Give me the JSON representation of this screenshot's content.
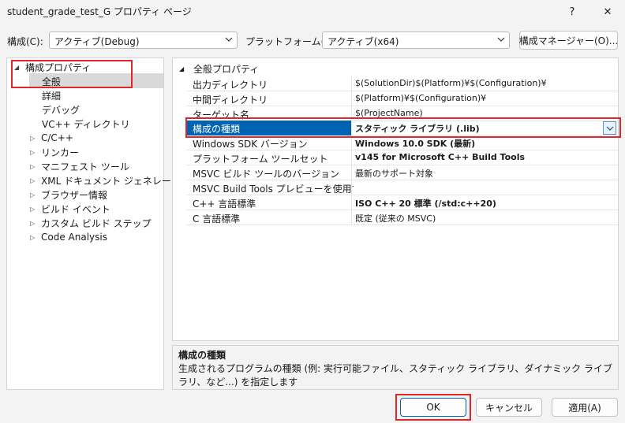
{
  "window": {
    "title": "student_grade_test_G プロパティ ページ",
    "help_label": "?",
    "close_label": "✕"
  },
  "toolbar": {
    "config_label": "構成(C):",
    "config_value": "アクティブ(Debug)",
    "platform_label": "プラットフォーム(P):",
    "platform_value": "アクティブ(x64)",
    "config_manager_label": "構成マネージャー(O)..."
  },
  "tree": {
    "root": {
      "label": "構成プロパティ",
      "expander": "◢"
    },
    "items": [
      {
        "label": "全般",
        "expander": ""
      },
      {
        "label": "詳細",
        "expander": ""
      },
      {
        "label": "デバッグ",
        "expander": ""
      },
      {
        "label": "VC++ ディレクトリ",
        "expander": ""
      },
      {
        "label": "C/C++",
        "expander": "▷"
      },
      {
        "label": "リンカー",
        "expander": "▷"
      },
      {
        "label": "マニフェスト ツール",
        "expander": "▷"
      },
      {
        "label": "XML ドキュメント ジェネレーター",
        "expander": "▷"
      },
      {
        "label": "ブラウザー情報",
        "expander": "▷"
      },
      {
        "label": "ビルド イベント",
        "expander": "▷"
      },
      {
        "label": "カスタム ビルド ステップ",
        "expander": "▷"
      },
      {
        "label": "Code Analysis",
        "expander": "▷"
      }
    ]
  },
  "grid": {
    "section_expander": "◢",
    "section_title": "全般プロパティ",
    "rows": [
      {
        "name": "出力ディレクトリ",
        "value": "$(SolutionDir)$(Platform)¥$(Configuration)¥"
      },
      {
        "name": "中間ディレクトリ",
        "value": "$(Platform)¥$(Configuration)¥"
      },
      {
        "name": "ターゲット名",
        "value": "$(ProjectName)"
      },
      {
        "name": "構成の種類",
        "value": "スタティック ライブラリ (.lib)"
      },
      {
        "name": "Windows SDK バージョン",
        "value": "Windows 10.0 SDK (最新)"
      },
      {
        "name": "プラットフォーム ツールセット",
        "value": "v145 for Microsoft C++ Build Tools"
      },
      {
        "name": "MSVC ビルド ツールのバージョン",
        "value": "最新のサポート対象"
      },
      {
        "name": "MSVC Build Tools プレビューを使用する",
        "value": ""
      },
      {
        "name": "C++ 言語標準",
        "value": "ISO C++ 20 標準 (/std:c++20)"
      },
      {
        "name": "C 言語標準",
        "value": "既定 (従来の MSVC)"
      }
    ]
  },
  "description": {
    "title": "構成の種類",
    "text": "生成されるプログラムの種類 (例: 実行可能ファイル、スタティック ライブラリ、ダイナミック ライブラリ、など...) を指定します"
  },
  "buttons": {
    "ok": "OK",
    "cancel": "キャンセル",
    "apply": "適用(A)"
  },
  "colors": {
    "accent": "#0063b1",
    "highlight": "#e0262b"
  }
}
